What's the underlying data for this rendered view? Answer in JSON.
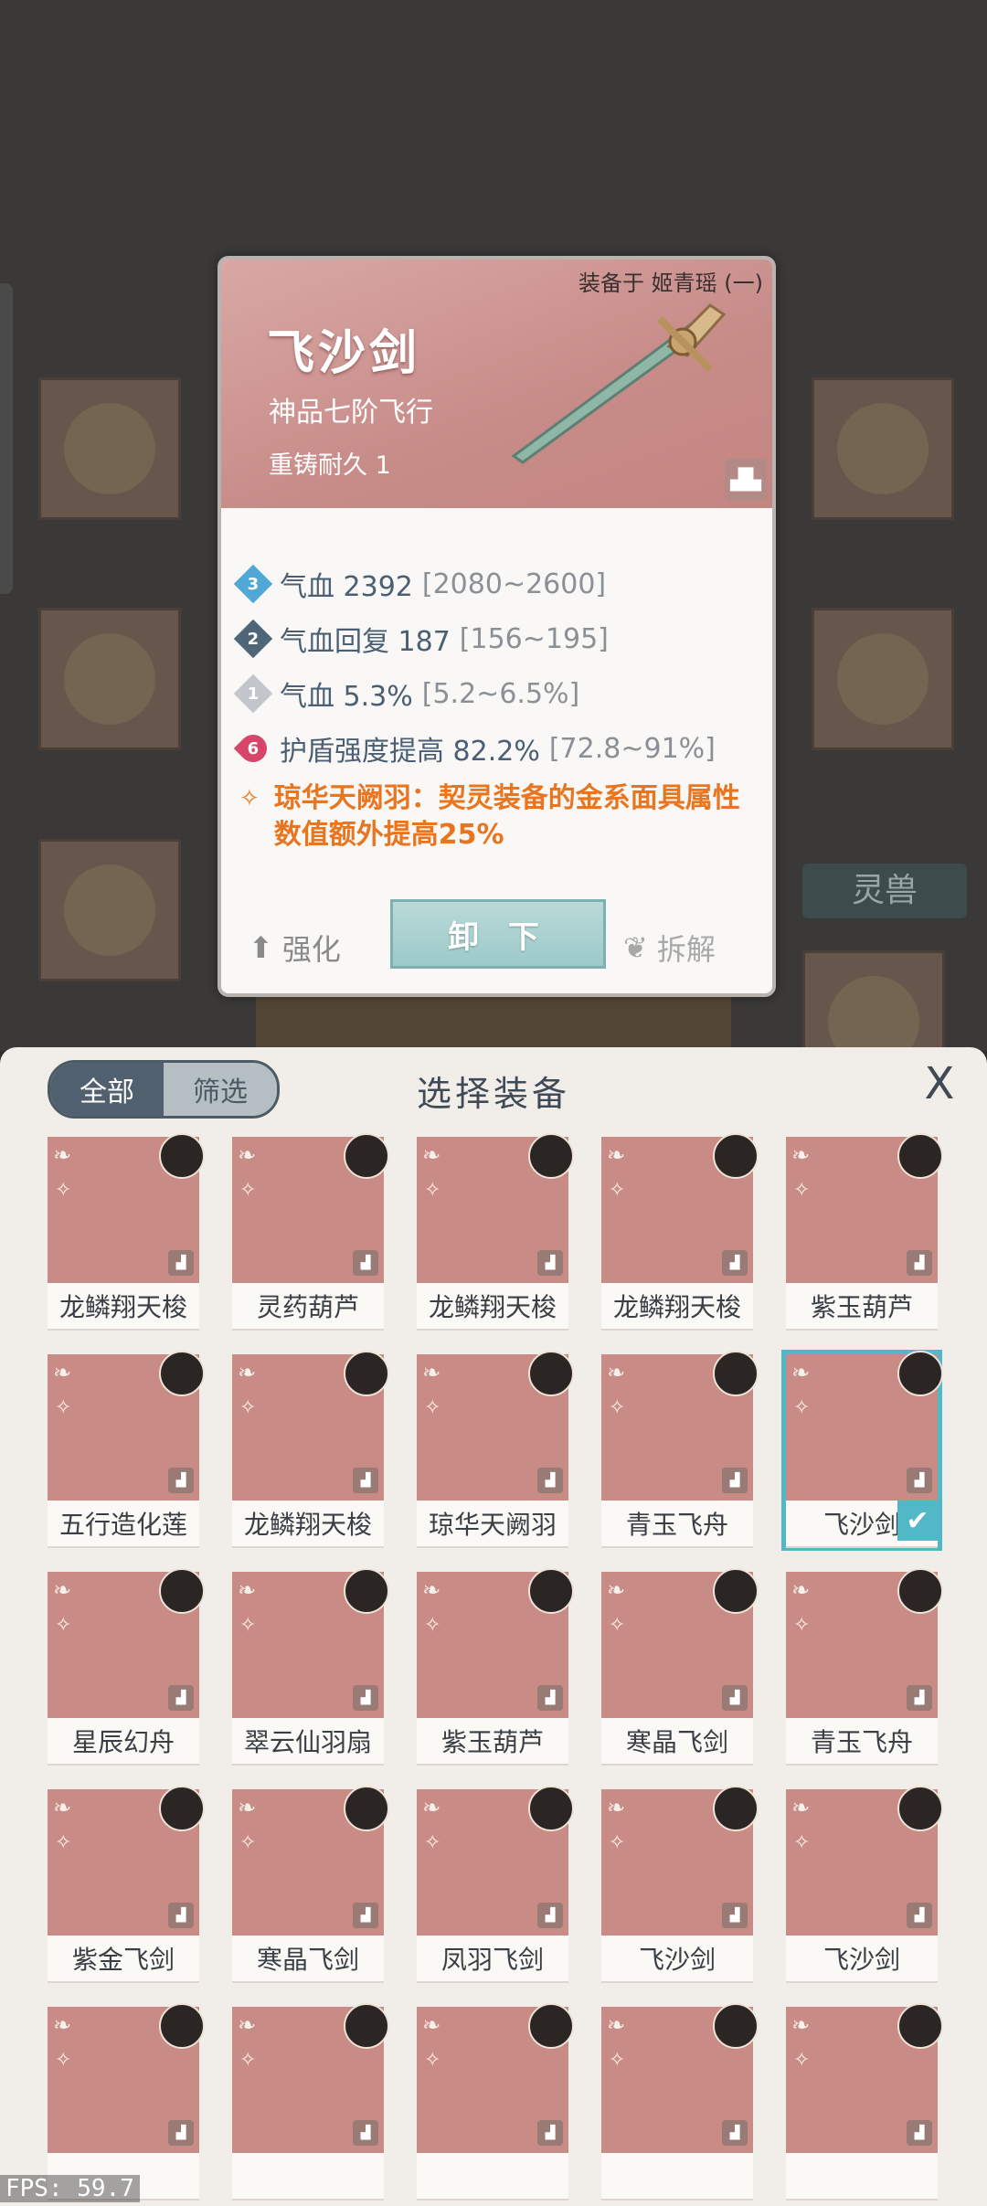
{
  "detail": {
    "equipped_on": "装备于 姬青瑶 (一)",
    "name": "飞沙剑",
    "grade": "神品七阶飞行",
    "recast": "重铸耐久 1",
    "stats": [
      {
        "rank": "3",
        "color": "#4fa8d6",
        "text": "气血 2392",
        "range": "[2080~2600]"
      },
      {
        "rank": "2",
        "color": "#4f6578",
        "text": "气血回复 187",
        "range": "[156~195]"
      },
      {
        "rank": "1",
        "color": "#c2c6ca",
        "text": "气血 5.3%",
        "range": "[5.2~6.5%]"
      },
      {
        "rank": "6",
        "color": "#d9456a",
        "text": "护盾强度提高 82.2%",
        "range": "[72.8~91%]"
      }
    ],
    "special": "琼华天阙羽：契灵装备的金系面具属性数值额外提高25%",
    "strengthen_label": "强化",
    "unequip_label": "卸 下",
    "dismantle_label": "拆解"
  },
  "background": {
    "pet_tab": "灵兽"
  },
  "selector": {
    "tabs": [
      "全部",
      "筛选"
    ],
    "title": "选择装备",
    "close": "X",
    "items": [
      {
        "name": "龙鳞翔天梭",
        "color": "#c98b85"
      },
      {
        "name": "灵药葫芦",
        "color": "#c98b85"
      },
      {
        "name": "龙鳞翔天梭",
        "color": "#c98b85"
      },
      {
        "name": "龙鳞翔天梭",
        "color": "#c98b85"
      },
      {
        "name": "紫玉葫芦",
        "color": "#c98b85"
      },
      {
        "name": "五行造化莲",
        "color": "#c98b85"
      },
      {
        "name": "龙鳞翔天梭",
        "color": "#c98b85"
      },
      {
        "name": "琼华天阙羽",
        "color": "#c98b85"
      },
      {
        "name": "青玉飞舟",
        "color": "#c98b85"
      },
      {
        "name": "飞沙剑",
        "color": "#c98b85",
        "selected": true
      },
      {
        "name": "星辰幻舟",
        "color": "#c98b85"
      },
      {
        "name": "翠云仙羽扇",
        "color": "#c98b85"
      },
      {
        "name": "紫玉葫芦",
        "color": "#c98b85"
      },
      {
        "name": "寒晶飞剑",
        "color": "#c98b85"
      },
      {
        "name": "青玉飞舟",
        "color": "#c98b85"
      },
      {
        "name": "紫金飞剑",
        "color": "#c98b85"
      },
      {
        "name": "寒晶飞剑",
        "color": "#c98b85"
      },
      {
        "name": "凤羽飞剑",
        "color": "#c98b85"
      },
      {
        "name": "飞沙剑",
        "color": "#c98b85"
      },
      {
        "name": "飞沙剑",
        "color": "#c98b85"
      },
      {
        "name": "",
        "color": "#c98b85"
      },
      {
        "name": "",
        "color": "#c98b85"
      },
      {
        "name": "",
        "color": "#c98b85"
      },
      {
        "name": "",
        "color": "#c98b85"
      },
      {
        "name": "",
        "color": "#c98b85"
      }
    ]
  },
  "fps": "FPS: 59.7"
}
